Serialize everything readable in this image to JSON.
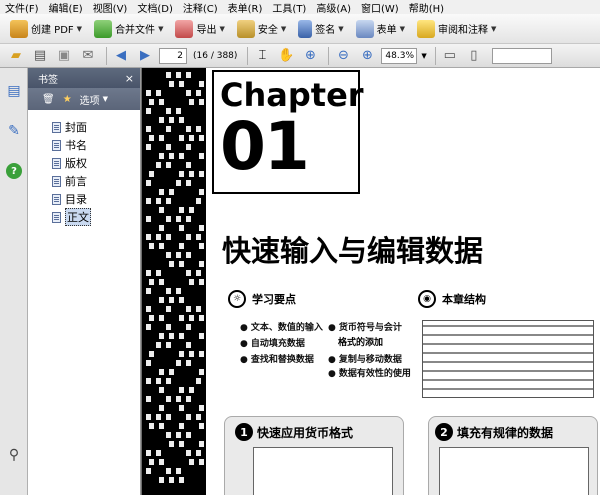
{
  "menu": [
    "文件(F)",
    "编辑(E)",
    "视图(V)",
    "文档(D)",
    "注释(C)",
    "表单(R)",
    "工具(T)",
    "高级(A)",
    "窗口(W)",
    "帮助(H)"
  ],
  "toolbar1": {
    "create_pdf": "创建 PDF",
    "combine": "合并文件",
    "export": "导出",
    "security": "安全",
    "sign": "签名",
    "forms": "表单",
    "review": "审阅和注释"
  },
  "toolbar2": {
    "page_current": "2",
    "page_total": "(16 / 388)",
    "zoom": "48.3%"
  },
  "bookmarks": {
    "title": "书签",
    "options": "选项",
    "items": [
      "封面",
      "书名",
      "版权",
      "前言",
      "目录",
      "正文"
    ],
    "selected_index": 5
  },
  "document": {
    "chapter_word": "Chapter",
    "chapter_num": "01",
    "title": "快速输入与编辑数据",
    "learning_head": "学习要点",
    "structure_head": "本章结构",
    "points_left": [
      "文本、数值的输入",
      "自动填充数据",
      "查找和替换数据"
    ],
    "points_right": [
      "货币符号与会计",
      "格式的添加",
      "复制与移动数据",
      "数据有效性的使用"
    ],
    "box1_title": "快速应用货币格式",
    "box2_title": "填充有规律的数据",
    "box1_num": "1",
    "box2_num": "2"
  },
  "colors": {
    "accent": "#3a6ec0",
    "panel_head": "#5e6a7e"
  }
}
